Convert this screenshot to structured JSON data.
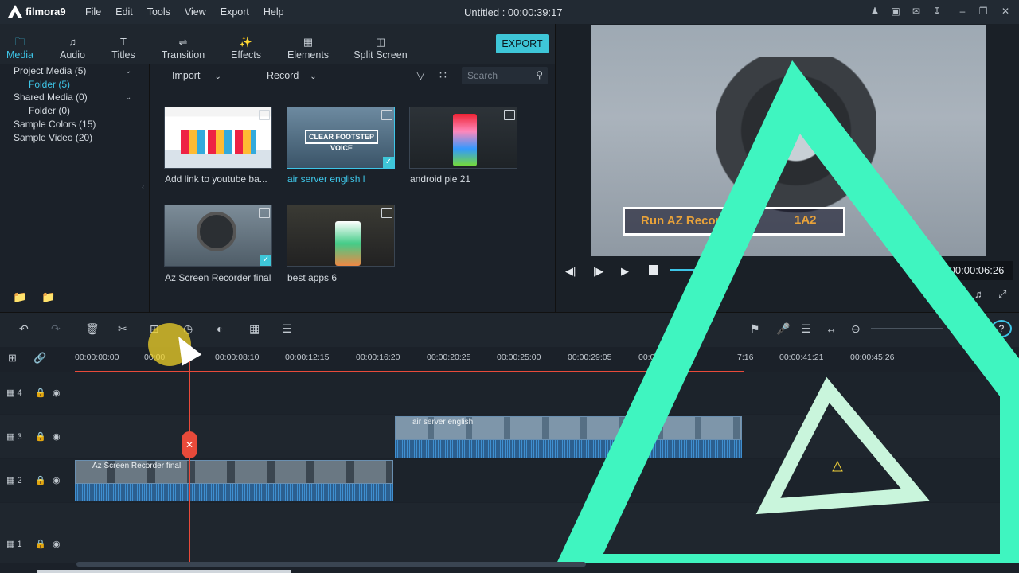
{
  "app": {
    "name": "filmora9",
    "title": "Untitled : 00:00:39:17"
  },
  "menu": [
    "File",
    "Edit",
    "Tools",
    "View",
    "Export",
    "Help"
  ],
  "tabs": [
    {
      "label": "Media",
      "icon": "folder-icon"
    },
    {
      "label": "Audio",
      "icon": "music-note-icon"
    },
    {
      "label": "Titles",
      "icon": "text-icon"
    },
    {
      "label": "Transition",
      "icon": "transition-icon"
    },
    {
      "label": "Effects",
      "icon": "effects-icon"
    },
    {
      "label": "Elements",
      "icon": "image-icon"
    },
    {
      "label": "Split Screen",
      "icon": "split-screen-icon"
    }
  ],
  "export_label": "EXPORT",
  "library": {
    "items": [
      {
        "label": "Project Media (5)"
      },
      {
        "label": "Folder (5)"
      },
      {
        "label": "Shared Media (0)"
      },
      {
        "label": "Folder (0)"
      },
      {
        "label": "Sample Colors (15)"
      },
      {
        "label": "Sample Video (20)"
      }
    ]
  },
  "media_toolbar": {
    "import": "Import",
    "record": "Record",
    "search_placeholder": "Search"
  },
  "media": [
    {
      "label": "Add link to youtube ba...",
      "selected": false,
      "checked": false
    },
    {
      "label": "air server english l",
      "selected": true,
      "checked": true
    },
    {
      "label": "android pie 21",
      "selected": false,
      "checked": false
    },
    {
      "label": "Az Screen Recorder final",
      "selected": false,
      "checked": true
    },
    {
      "label": "best apps 6",
      "selected": false,
      "checked": false
    }
  ],
  "preview": {
    "timecode": "00:00:06:26",
    "overlay_text": "Run AZ Record",
    "overlay_text2": "1A2"
  },
  "ruler": [
    "00:00:00:00",
    "00:00",
    "00:00:08:10",
    "00:00:12:15",
    "00:00:16:20",
    "00:00:20:25",
    "00:00:25:00",
    "00:00:29:05",
    "00:00:33:10",
    "7:16",
    "00:00:41:21",
    "00:00:45:26",
    "00:00"
  ],
  "tracks": [
    {
      "label": "4"
    },
    {
      "label": "3"
    },
    {
      "label": "2"
    },
    {
      "label": "1"
    }
  ],
  "clips": {
    "clip_a": "air server english",
    "clip_b": "Az Screen Recorder final"
  },
  "colors": {
    "accent": "#3ec6e8",
    "triangle": "#3ff5c0",
    "playhead": "#e84a3a"
  }
}
